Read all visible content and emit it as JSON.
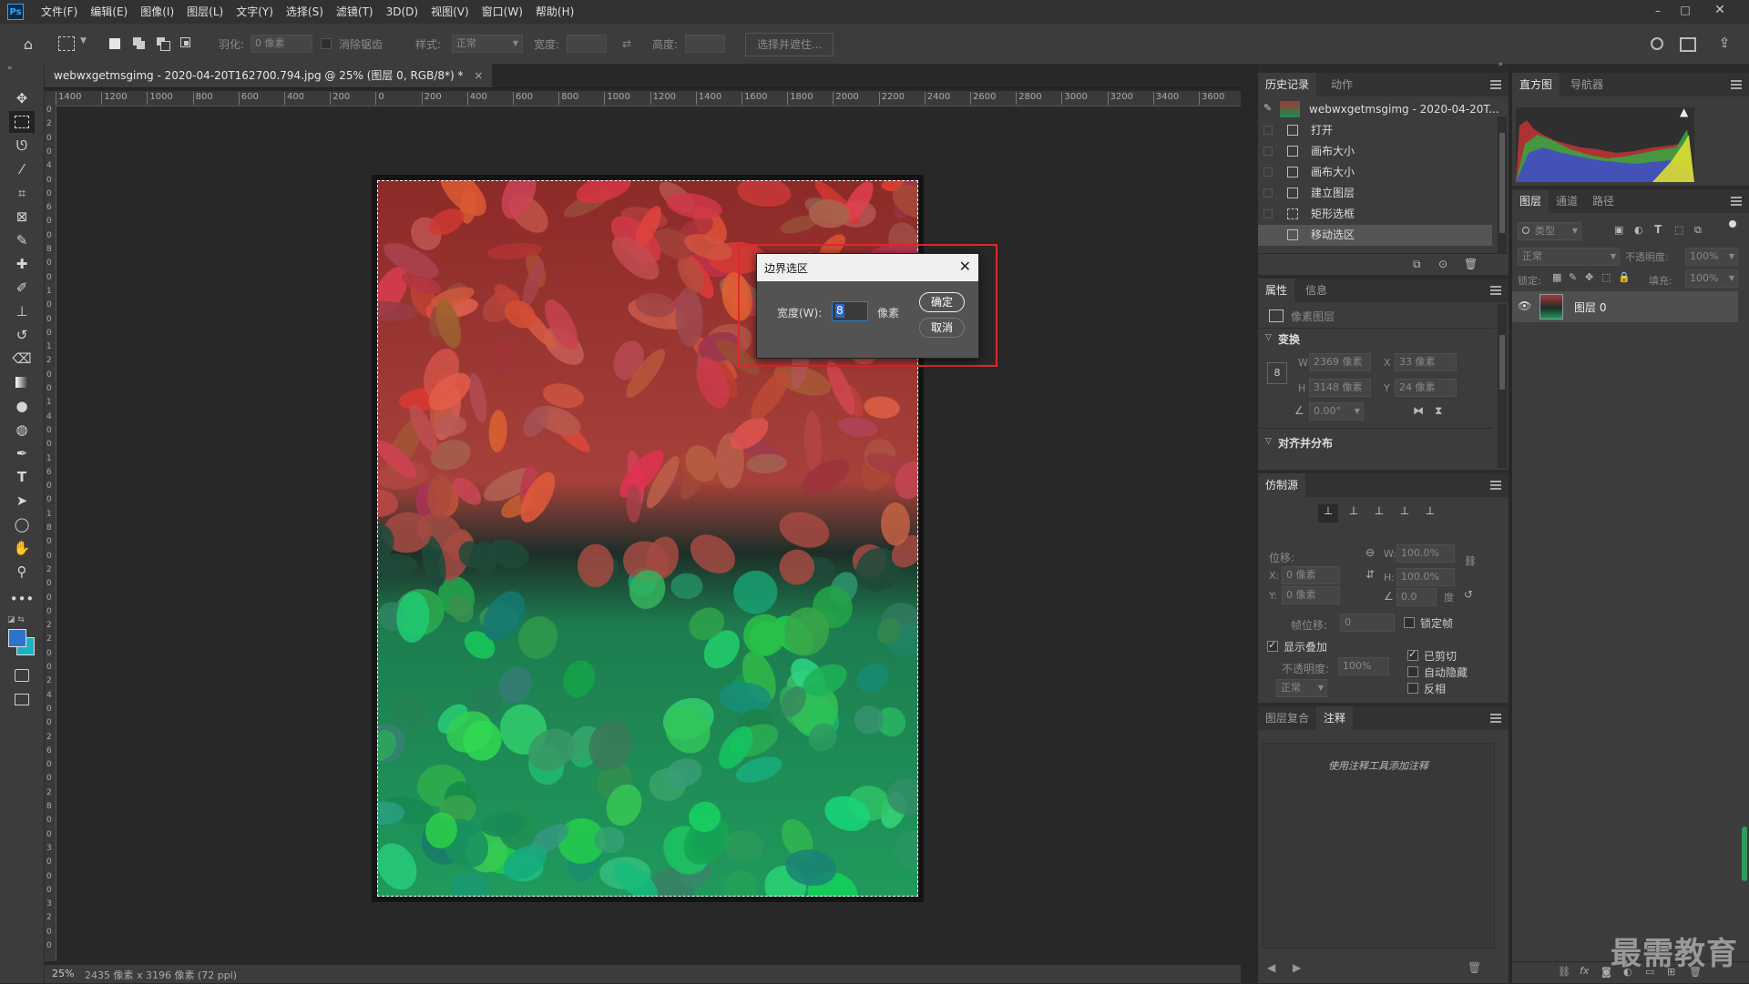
{
  "app": {
    "logo": "Ps",
    "menu": [
      "文件(F)",
      "编辑(E)",
      "图像(I)",
      "图层(L)",
      "文字(Y)",
      "选择(S)",
      "滤镜(T)",
      "3D(D)",
      "视图(V)",
      "窗口(W)",
      "帮助(H)"
    ]
  },
  "options_bar": {
    "feather_label": "羽化:",
    "feather_value": "0 像素",
    "antialias_label": "消除锯齿",
    "style_label": "样式:",
    "style_value": "正常",
    "width_label": "宽度:",
    "height_label": "高度:",
    "select_mask_label": "选择并遮住..."
  },
  "document": {
    "tab_title": "webwxgetmsgimg - 2020-04-20T162700.794.jpg @ 25% (图层 0, RGB/8*) *",
    "ruler_h": [
      "1400",
      "1200",
      "1000",
      "800",
      "600",
      "400",
      "200",
      "0",
      "200",
      "400",
      "600",
      "800",
      "1000",
      "1200",
      "1400",
      "1600",
      "1800",
      "2000",
      "2200",
      "2400",
      "2600",
      "2800",
      "3000",
      "3200",
      "3400",
      "3600"
    ],
    "ruler_v": [
      "0",
      "2",
      "0",
      "0",
      "4",
      "0",
      "0",
      "6",
      "0",
      "0",
      "8",
      "0",
      "0",
      "1",
      "0",
      "0",
      "0",
      "1",
      "2",
      "0",
      "0",
      "1",
      "4",
      "0",
      "0",
      "1",
      "6",
      "0",
      "0",
      "1",
      "8",
      "0",
      "0",
      "2",
      "0",
      "0",
      "0",
      "2",
      "2",
      "0",
      "0",
      "2",
      "4",
      "0",
      "0",
      "2",
      "6",
      "0",
      "0",
      "2",
      "8",
      "0",
      "0",
      "3",
      "0",
      "0",
      "0",
      "3",
      "2",
      "0",
      "0"
    ]
  },
  "status": {
    "zoom": "25%",
    "info": "2435 像素 x 3196 像素 (72 ppi)"
  },
  "dialog": {
    "title": "边界选区",
    "width_label": "宽度(W):",
    "width_value": "8",
    "unit": "像素",
    "ok": "确定",
    "cancel": "取消"
  },
  "history": {
    "tabs": [
      "历史记录",
      "动作"
    ],
    "snapshot": "webwxgetmsgimg - 2020-04-20T...",
    "items": [
      "打开",
      "画布大小",
      "画布大小",
      "建立图层",
      "矩形选框",
      "移动选区"
    ]
  },
  "properties": {
    "tabs": [
      "属性",
      "信息"
    ],
    "layer_type": "像素图层",
    "transform_title": "变换",
    "w_label": "W",
    "w_value": "2369 像素",
    "x_label": "X",
    "x_value": "33 像素",
    "h_label": "H",
    "h_value": "3148 像素",
    "y_label": "Y",
    "y_value": "24 像素",
    "angle_value": "0.00°",
    "align_title": "对齐并分布"
  },
  "clone": {
    "tab": "仿制源",
    "offset_label": "位移:",
    "w_label": "W:",
    "w_value": "100.0%",
    "h_label": "H:",
    "h_value": "100.0%",
    "x_label": "X:",
    "x_value": "0 像素",
    "y_label": "Y:",
    "y_value": "0 像素",
    "angle_value": "0.0",
    "degree": "度",
    "frame_offset_label": "帧位移:",
    "frame_offset_value": "0",
    "lock_frame": "锁定帧",
    "show_overlay": "显示叠加",
    "opacity_label": "不透明度:",
    "opacity_value": "100%",
    "clipped": "已剪切",
    "auto_hide": "自动隐藏",
    "invert": "反相",
    "blend_value": "正常"
  },
  "notes": {
    "tabs": [
      "图层复合",
      "注释"
    ],
    "hint": "使用注释工具添加注释"
  },
  "histogram": {
    "tabs": [
      "直方图",
      "导航器"
    ]
  },
  "layers": {
    "tabs": [
      "图层",
      "通道",
      "路径"
    ],
    "filter_placeholder": "类型",
    "blend_mode": "正常",
    "opacity_label": "不透明度:",
    "opacity_value": "100%",
    "lock_label": "锁定:",
    "fill_label": "填充:",
    "fill_value": "100%",
    "layer_name": "图层 0"
  },
  "watermark": "最需教育",
  "colors": {
    "accent_red": "#e0272c",
    "panel": "#3c3c3c",
    "canvas": "#282828"
  }
}
